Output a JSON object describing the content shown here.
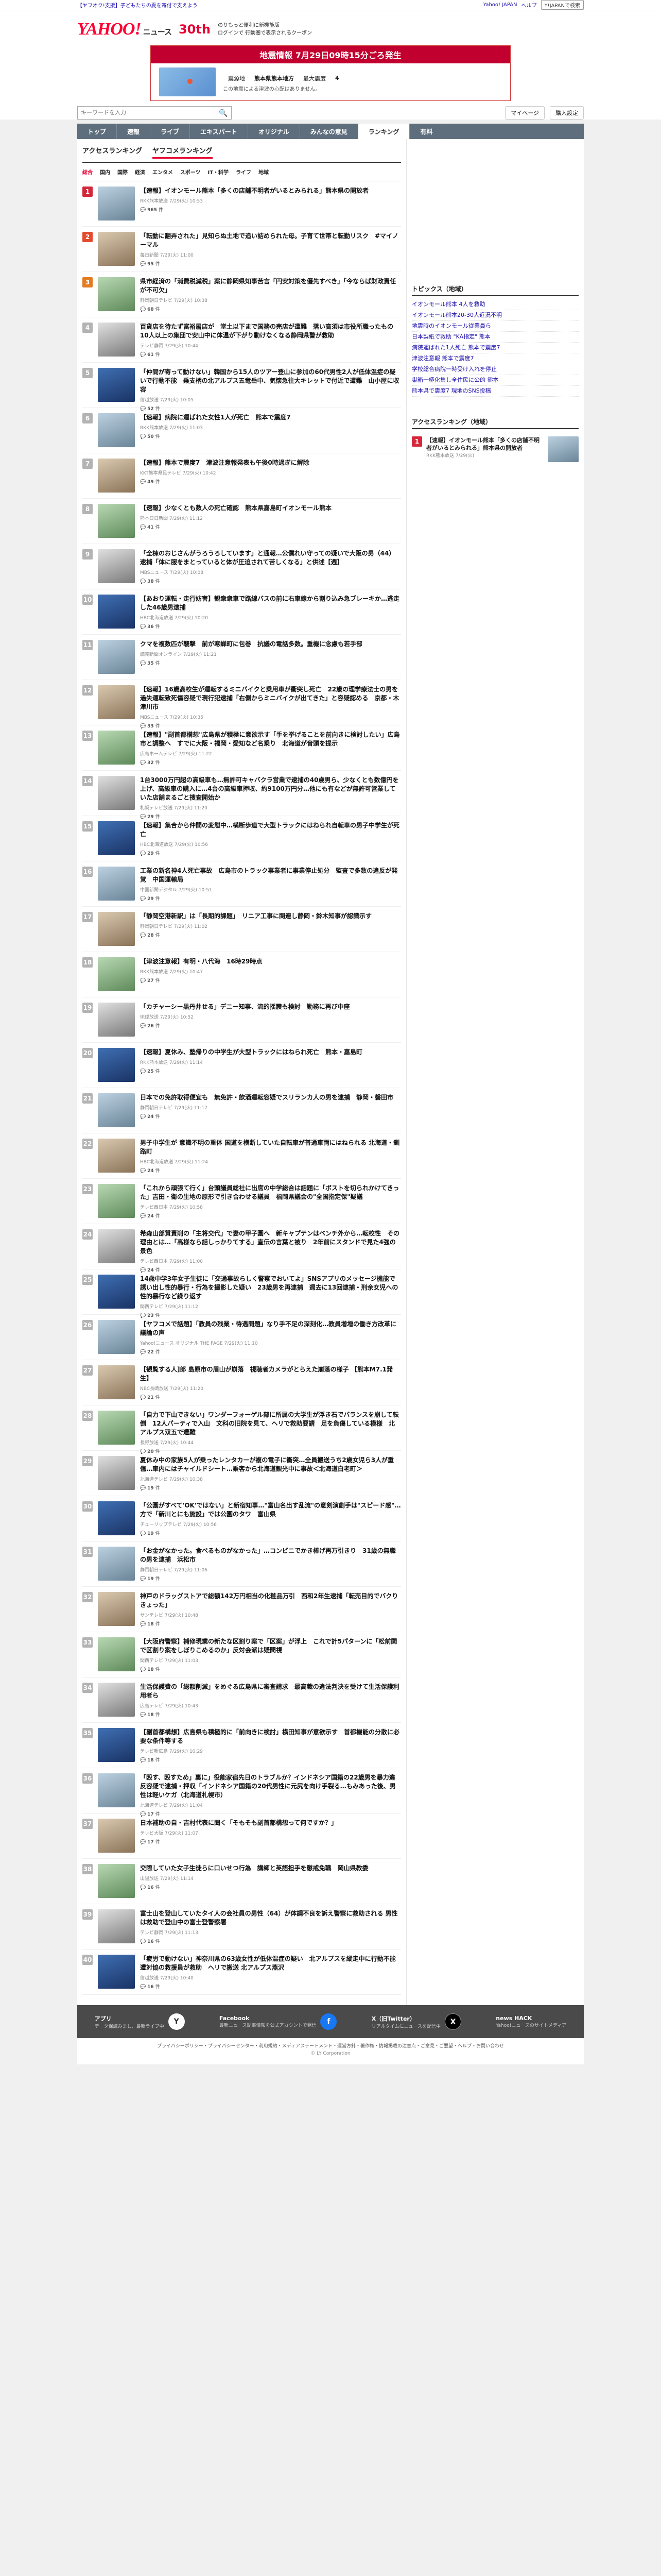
{
  "topbar": {
    "left": "【ヤフオク!支援】子どもたちの夏を寄付で支えよう",
    "login": "Yahoo! JAPAN",
    "help": "ヘルプ",
    "search_btn": "Y!JAPANで検索"
  },
  "header": {
    "logo": "YAHOO!",
    "logo_sub": "ニュース",
    "anniversary": "30th",
    "promo1": "のりもっと便利に新機能版",
    "promo2": "ログインで 行動圏で表示されるクーポン",
    "promo_red": "新機能版"
  },
  "alert": {
    "title": "地震情報 7月29日09時15分ごろ発生",
    "row1_label": "震源地",
    "row1_value": "熊本県熊本地方",
    "row1_label2": "最大震度",
    "row1_value2": "4",
    "note": "この地震による津波の心配はありません。"
  },
  "search": {
    "placeholder": "キーワードを入力",
    "mypage": "マイページ",
    "region": "購入設定"
  },
  "nav": [
    "トップ",
    "速報",
    "ライブ",
    "エキスパート",
    "オリジナル",
    "みんなの意見",
    "ランキング",
    "有料"
  ],
  "subtabs": [
    "アクセスランキング",
    "ヤフコメランキング"
  ],
  "cats": [
    "総合",
    "国内",
    "国際",
    "経済",
    "エンタメ",
    "スポーツ",
    "IT・科学",
    "ライフ",
    "地域"
  ],
  "items": [
    {
      "rank": "1",
      "title": "【速報】イオンモール熊本「多くの店舗不明者がいるとみられる」熊本県の開放者",
      "meta": "RKK熊本放送 7/29(火) 10:53",
      "cmt": "965"
    },
    {
      "rank": "2",
      "title": "「転動に翻弄された」見知らぬ土地で追い詰められた母。子育て世帯と転勤リスク　#マイノーマル",
      "meta": "毎日新聞 7/29(火) 11:00",
      "cmt": "95"
    },
    {
      "rank": "3",
      "title": "県市経済の「消費税減税」案に静岡県知事苦言「円安対策を優先すべき」「今ならば財政責任が不可欠」",
      "meta": "静岡朝日テレビ 7/29(火) 10:38",
      "cmt": "68"
    },
    {
      "rank": "4",
      "title": "百貨店を待たず富裕層店が　堂土以下まで国務の売店が遭難　落い高須は市役所職ったもの　10人以上の集団で安山中に体温が下がり動けなくなる静岡県警が救助",
      "meta": "テレビ静岡 7/29(火) 10:44",
      "cmt": "61"
    },
    {
      "rank": "5",
      "title": "「仲間が寄って動けない」韓国から15人のツアー登山に参加の60代男性2人が低体温症の疑いで行動不能　乗支柄の北アルプス五竜岳中、気懐急往大キレットで付近で遭難　山小屋に収容",
      "meta": "信越放送 7/29(火) 10:05",
      "cmt": "52"
    },
    {
      "rank": "6",
      "title": "【速報】病院に運ばれた女性1人が死亡　熊本で震度7",
      "meta": "RKK熊本放送 7/29(火) 11:03",
      "cmt": "50"
    },
    {
      "rank": "7",
      "title": "【速報】熊本で震度7　津波注意報発表も午後0時過ぎに解除",
      "meta": "KKT熊本県民テレビ 7/29(火) 10:42",
      "cmt": "49"
    },
    {
      "rank": "8",
      "title": "【速報】少なくとも数人の死亡確認　熊本県嘉島町イオンモール熊本",
      "meta": "熊本日日新聞 7/29(火) 11:12",
      "cmt": "41"
    },
    {
      "rank": "9",
      "title": "「全棟のおじさんがうろうろしています」と通報…公僕れい守っての疑いで大阪の男（44）逮捕「体に服をまとっていると体が圧迫されて苦しくなる」と供述【週】",
      "meta": "MBSニュース 7/29(火) 10:08",
      "cmt": "38"
    },
    {
      "rank": "10",
      "title": "【あおり運転・走行妨害】観衆衆車で路線バスの前に右車線から割り込み急ブレーキか…逃走した46歳男逮捕",
      "meta": "HBC北海道放送 7/29(火) 10:20",
      "cmt": "36"
    },
    {
      "rank": "11",
      "title": "クマを複数匹が襲撃　前が寒蝉町に包巻　抗議の電話多数。重機に念慮も若手部",
      "meta": "読売新聞オンライン 7/29(火) 11:21",
      "cmt": "35"
    },
    {
      "rank": "12",
      "title": "【速報】16歳高校生が運転するミニバイクと乗用車が衝突し死亡　22歳の理学療法士の男を過失運転致死傷容疑で現行犯逮捕「右側からミニバイクが出てきた」と容疑認める　京都・木津川市",
      "meta": "MBSニュース 7/29(火) 10:35",
      "cmt": "33"
    },
    {
      "rank": "13",
      "title": "【速報】\"副首都構想\"広島県が積極に意欲示す「手を挙げることを前向きに検討したい」広島市と調整へ　すでに大阪・福岡・愛知など名乗り　北海道が音頭を提示",
      "meta": "広島ホームテレビ 7/29(火) 11:22",
      "cmt": "32"
    },
    {
      "rank": "14",
      "title": "1台3000万円超の高級車も…無許可キャバクラ営業で逮捕の40歳男ら、少なくとも数億円を上げ、高級車の購入に…4台の高級車押収、約9100万円分…他にも有などが無許可営業していた店舗まるごと捜査開始か",
      "meta": "札幌テレビ放送 7/29(火) 11:20",
      "cmt": "29"
    },
    {
      "rank": "15",
      "title": "【速報】集合から仲間の変態中…横断歩道で大型トラックにはねられ自転車の男子中学生が死亡",
      "meta": "HBC北海道放送 7/29(火) 10:56",
      "cmt": "29"
    },
    {
      "rank": "16",
      "title": "工業の新名神4人死亡事故　広島市のトラック事業者に事業停止処分　監査で多数の違反が発覚　中国運輸局",
      "meta": "中国新聞デジタル 7/29(火) 10:51",
      "cmt": "29"
    },
    {
      "rank": "17",
      "title": "「静岡空港新駅」は「長期的課題」　リニア工事に関連し静岡・鈴木知事が認識示す",
      "meta": "静岡朝日テレビ 7/29(火) 11:02",
      "cmt": "28"
    },
    {
      "rank": "18",
      "title": "【津波注意報】有明・八代海　16時29時点",
      "meta": "RKK熊本放送 7/29(火) 10:47",
      "cmt": "27"
    },
    {
      "rank": "19",
      "title": "「カチャーシー黒丹井せる」デニー知事、流的揺震も検討　勤務に再び中座",
      "meta": "琉球放送 7/29(火) 10:52",
      "cmt": "26"
    },
    {
      "rank": "20",
      "title": "【速報】夏休み、塾帰りの中学生が大型トラックにはねられ死亡　熊本・嘉島町",
      "meta": "RKK熊本放送 7/29(火) 11:14",
      "cmt": "25"
    },
    {
      "rank": "21",
      "title": "日本での免許取得便宜も　無免許・飲酒運転容疑でスリランカ人の男を逮捕　静岡・磐田市",
      "meta": "静岡朝日テレビ 7/29(火) 11:17",
      "cmt": "24"
    },
    {
      "rank": "22",
      "title": "男子中学生が 意識不明の重体 国道を横断していた自転車が普通車両にはねられる 北海道・釧路町",
      "meta": "HBC北海道放送 7/29(火) 11:24",
      "cmt": "24"
    },
    {
      "rank": "23",
      "title": "「これから頑張て行く」台頭議員総社に出席の中学総合は話題に「ボストを切られかけてきった」吉田・衛の生地の原形で引き合わせる議員　福岡県議会の\"全国指定保\"疑議",
      "meta": "テレビ西日本 7/29(火) 10:58",
      "cmt": "24"
    },
    {
      "rank": "24",
      "title": "希森山部質責削の「主将交代」で妻の甲子園へ　新キャプテンはベンチ外から…転校性　その理由とは…「高様なら話しっかりてする」直伝の言葉と被り　2年前にスタンドで見た4強の景色",
      "meta": "テレビ西日本 7/29(火) 11:00",
      "cmt": "24"
    },
    {
      "rank": "25",
      "title": "14歳中学3年女子生徒に「交通事故らしく警察でおいてよ」SNSアプリのメッセージ機能で誘い出し性的暴行・行為を撮影した疑い　23歳男を再逮捕　週去に13回逮捕・刑余女児への性的暴行など繰り返す",
      "meta": "関西テレビ 7/29(火) 11:12",
      "cmt": "23"
    },
    {
      "rank": "26",
      "title": "【ヤフコメで話題】「教員の残業・待遇問題」なり手不足の深刻化…教員増増の働き方改革に議論の声",
      "meta": "Yahoo!ニュース オリジナル THE PAGE 7/29(火) 11:10",
      "cmt": "22"
    },
    {
      "rank": "27",
      "title": "【観覧する人]郎 島原市の眉山が崩落　視聴者カメラがとらえた崩落の様子 【熊本M7.1発生】",
      "meta": "NBC長崎放送 7/29(火) 11:20",
      "cmt": "21"
    },
    {
      "rank": "28",
      "title": "「自力で下山できない」ワンダーフォーゲル部に所属の大学生が浮き石でバランスを崩して転倒　12人パーティで入山　文科の旧院を見て、ヘリで救助要請　足を負傷している模様　北アルプス双五で遭難",
      "meta": "長野放送 7/29(火) 10:44",
      "cmt": "20"
    },
    {
      "rank": "29",
      "title": "夏休み中の家族5人が乗ったレンタカーが複の電子に衝突…全員搬送うち2歳女児ら3人が重傷…車内にはチャイルドシート…乗客から北海道観光中に事故＜北海道白老町＞",
      "meta": "北海道テレビ 7/29(火) 10:38",
      "cmt": "19"
    },
    {
      "rank": "30",
      "title": "「公園がすべて'OK'ではない」と新宿知事…\"富山名出す乱流\"の意剣演劇手は\"スピード感\"…方で「新川とにも施設」では公園のタワ　富山県",
      "meta": "チューリップテレビ 7/29(火) 10:56",
      "cmt": "19"
    },
    {
      "rank": "31",
      "title": "「お金がなかった。食べるものがなかった」…コンビニでかき棒げ再万引きり　31歳の無職の男を逮捕　浜松市",
      "meta": "静岡朝日テレビ 7/29(火) 11:06",
      "cmt": "19"
    },
    {
      "rank": "32",
      "title": "神戸のドラッグストアで総額142万円相当の化粧品万引　西和2年生逮捕「転売目的でバクりきょった」",
      "meta": "サンテレビ 7/29(火) 10:48",
      "cmt": "18"
    },
    {
      "rank": "33",
      "title": "【大阪府警察】補修現業の新たな区割り案で「区案」が浮上　これで計5パターンに「松前関で区割り案をしぼりこめるのか」反対会派は疑問視",
      "meta": "関西テレビ 7/29(火) 11:03",
      "cmt": "18"
    },
    {
      "rank": "34",
      "title": "生活保護費の「総額削減」をめぐる広島県に審査請求　最高裁の違法判決を受けて生活保護利用者ら",
      "meta": "広島テレビ 7/29(火) 10:43",
      "cmt": "18"
    },
    {
      "rank": "35",
      "title": "【副首都構想】広島県も積極的に「前向きに検討」横田知事が意欲示す　首都機能の分散に必要な条件等する",
      "meta": "テレビ新広島 7/29(火) 10:29",
      "cmt": "18"
    },
    {
      "rank": "36",
      "title": "「殴す、殴すため」裏に」役能家宿先日のトラブルか？インドネシア国籍の22歳男を暴力違反容疑で逮捕・押収「インドネシア国籍の20代男性に元尻を向け手裂る…もみあった後、男性は軽いケガ（北海道札幌市）",
      "meta": "北海道テレビ 7/29(火) 11:04",
      "cmt": "17"
    },
    {
      "rank": "37",
      "title": "日本補助の自・吉村代表に聞く「そもそも副首都構想って何ですか？」",
      "meta": "テレビ大阪 7/29(火) 11:07",
      "cmt": "17"
    },
    {
      "rank": "38",
      "title": "交際していた女子生徒らに口いせつ行為　講師と英語担手を懲戒免職　岡山県教委",
      "meta": "山陽放送 7/29(火) 11:14",
      "cmt": "16"
    },
    {
      "rank": "39",
      "title": "富士山を登山していたタイ人の会社員の男性（64）が体調不良を訴え警察に救助される 男性は救助で登山中の富士登警察署",
      "meta": "テレビ静岡 7/29(火) 11:13",
      "cmt": "16"
    },
    {
      "rank": "40",
      "title": "「疲労で動けない」神奈川県の63歳女性が低体温症の疑い　北アルプスを縦走中に行動不能　遭対協の救援員が救助　ヘリで搬送 北アルプス燕沢",
      "meta": "信越放送 7/29(火) 10:40",
      "cmt": "16"
    }
  ],
  "topics": {
    "title": "トピックス（地域）",
    "items": [
      "イオンモール熊本 4人を救助",
      "イオンモール熊本20-30人近況不明",
      "地震時のイオンモール従業員ら",
      "日本製紙で救助 \"KA指定\" 熊本",
      "病院運ばれた1人死亡 熊本で震度7",
      "津波注意報 熊本で震度7",
      "学校総合病院一時受け入れを停止",
      "巣箱一極化集し全住民に公的 熊本",
      "熊本県で震度7 現地のSNS投稿"
    ]
  },
  "access": {
    "title": "アクセスランキング（地域）",
    "item_title": "【速報】イオンモール熊本「多くの店舗不明者がいるとみられる」熊本県の開放者",
    "item_meta": "RKK熊本放送 7/29(火)"
  },
  "footer": {
    "app": "アプリ",
    "app_sub": "データ保読みまし、最新ライブ中",
    "fb": "Facebook",
    "fb_sub": "最新ニュース記事情報を公式アカウントで発信",
    "x": "X（旧Twitter）",
    "x_sub": "リアルタイムにニュースを配信中",
    "hack": "news HACK",
    "hack_sub": "Yahoo!ニュースのサイトメディア"
  },
  "links": "プライバシーポリシー・プライバシーセンター・利用規約・メディアステートメント・運営方針・著作権・情報掲載の注意点・ご意見・ご要望・ヘルプ・お問い合わせ",
  "copyright": "© LY Corporation"
}
